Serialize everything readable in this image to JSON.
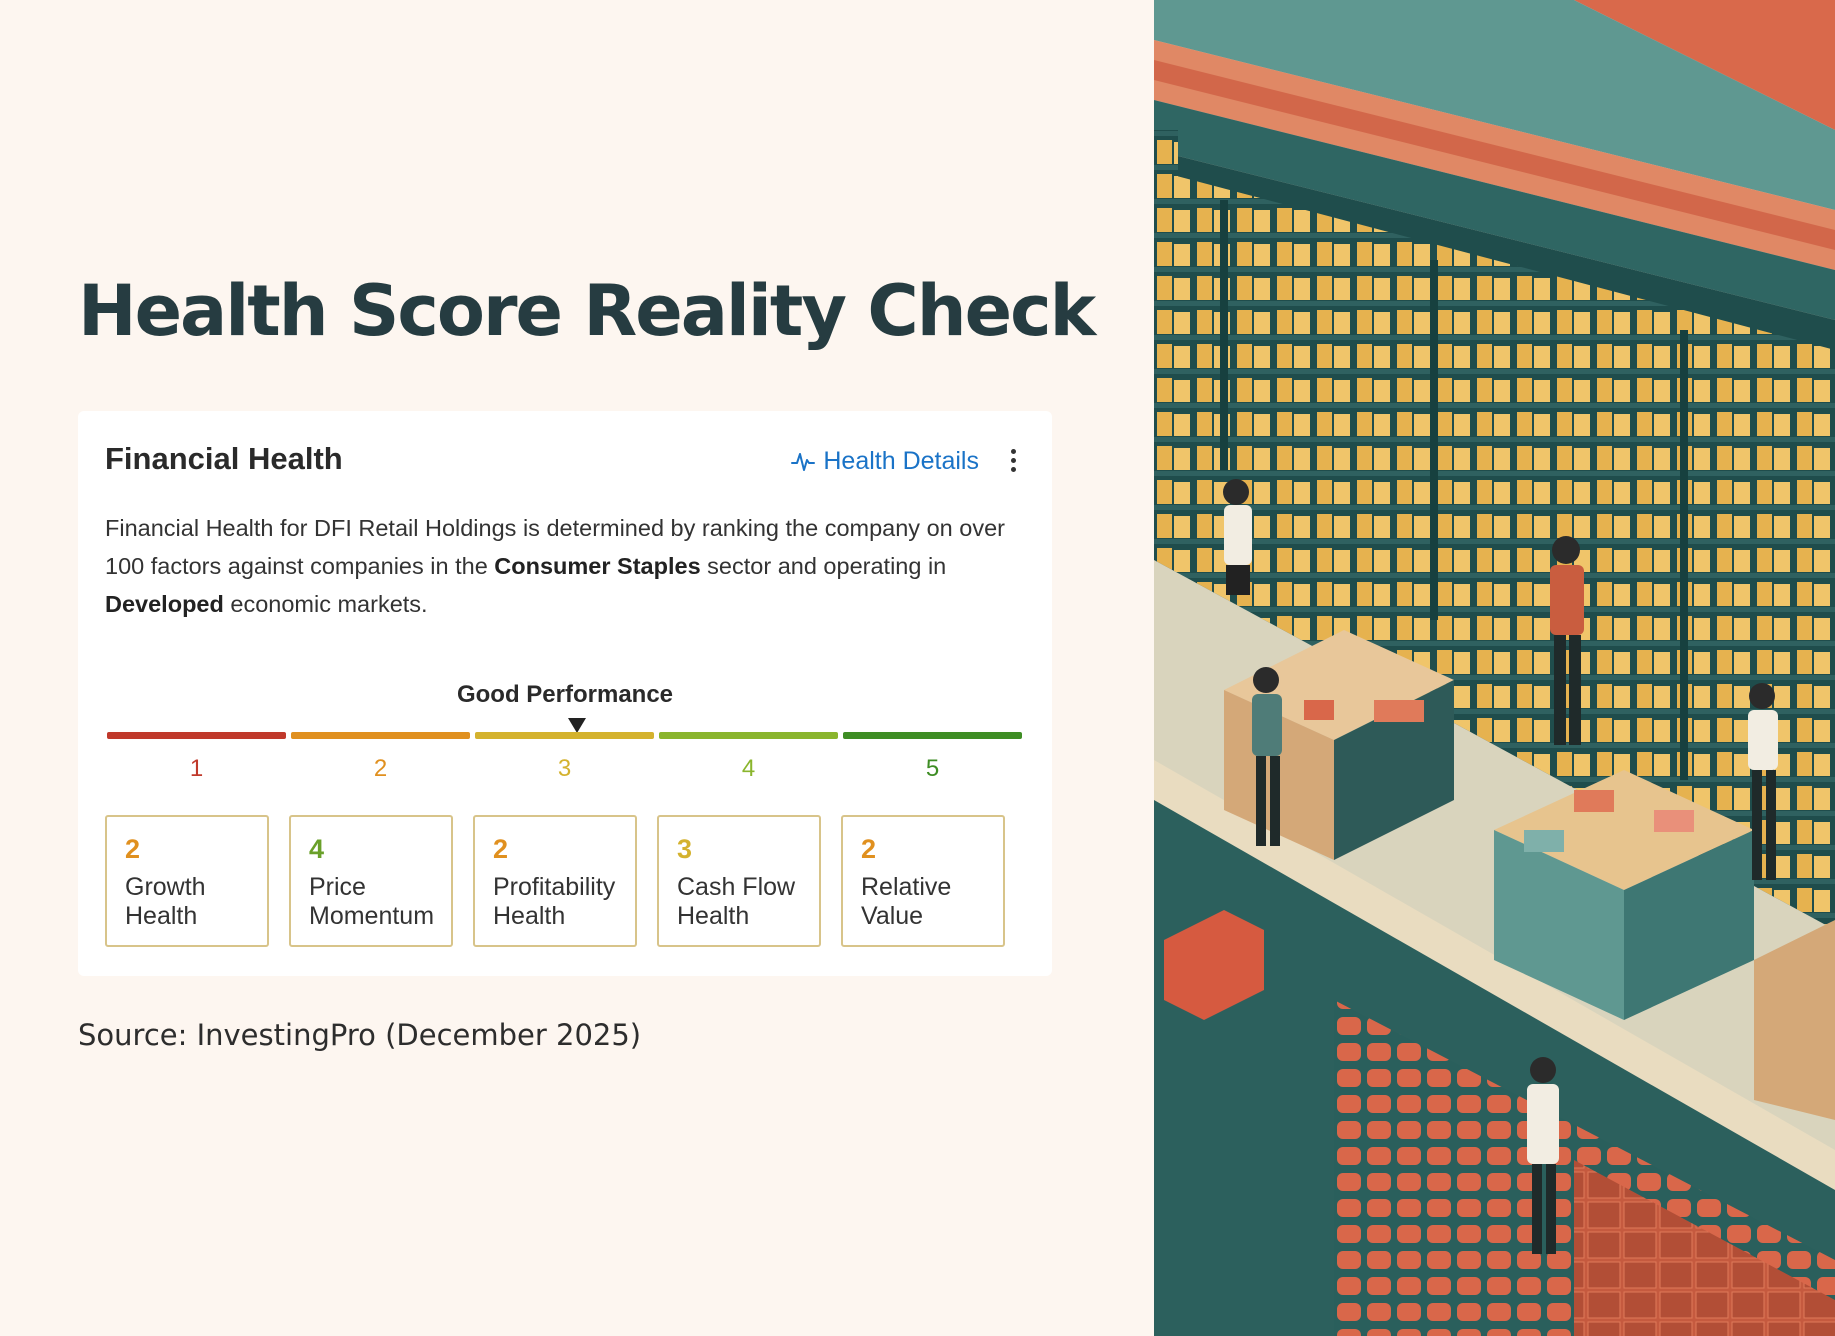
{
  "page": {
    "title": "Health Score Reality Check",
    "source": "Source: InvestingPro (December 2025)"
  },
  "card": {
    "title": "Financial Health",
    "details_link": "Health Details",
    "description": {
      "part1": "Financial Health for DFI Retail Holdings is determined by ranking the company on over 100 factors against companies in the ",
      "sector": "Consumer Staples",
      "part2": " sector and operating in ",
      "market": "Developed",
      "part3": " economic markets."
    },
    "performance_label": "Good Performance",
    "current_score": 3,
    "scale": [
      {
        "value": "1",
        "color": "#c0392b"
      },
      {
        "value": "2",
        "color": "#e0901f"
      },
      {
        "value": "3",
        "color": "#d4b22e"
      },
      {
        "value": "4",
        "color": "#8ab52d"
      },
      {
        "value": "5",
        "color": "#3e8d24"
      }
    ],
    "scores": [
      {
        "value": "2",
        "line1": "Growth",
        "line2": "Health",
        "color": "#e0901f"
      },
      {
        "value": "4",
        "line1": "Price",
        "line2": "Momentum",
        "color": "#6aa02a"
      },
      {
        "value": "2",
        "line1": "Profitability",
        "line2": "Health",
        "color": "#e0901f"
      },
      {
        "value": "3",
        "line1": "Cash Flow",
        "line2": "Health",
        "color": "#d4b22e"
      },
      {
        "value": "2",
        "line1": "Relative",
        "line2": "Value",
        "color": "#e0901f"
      }
    ]
  },
  "colors": {
    "background": "#fdf6f0",
    "title": "#263c41",
    "link": "#1a73c7",
    "box_border": "#d8c48a"
  }
}
